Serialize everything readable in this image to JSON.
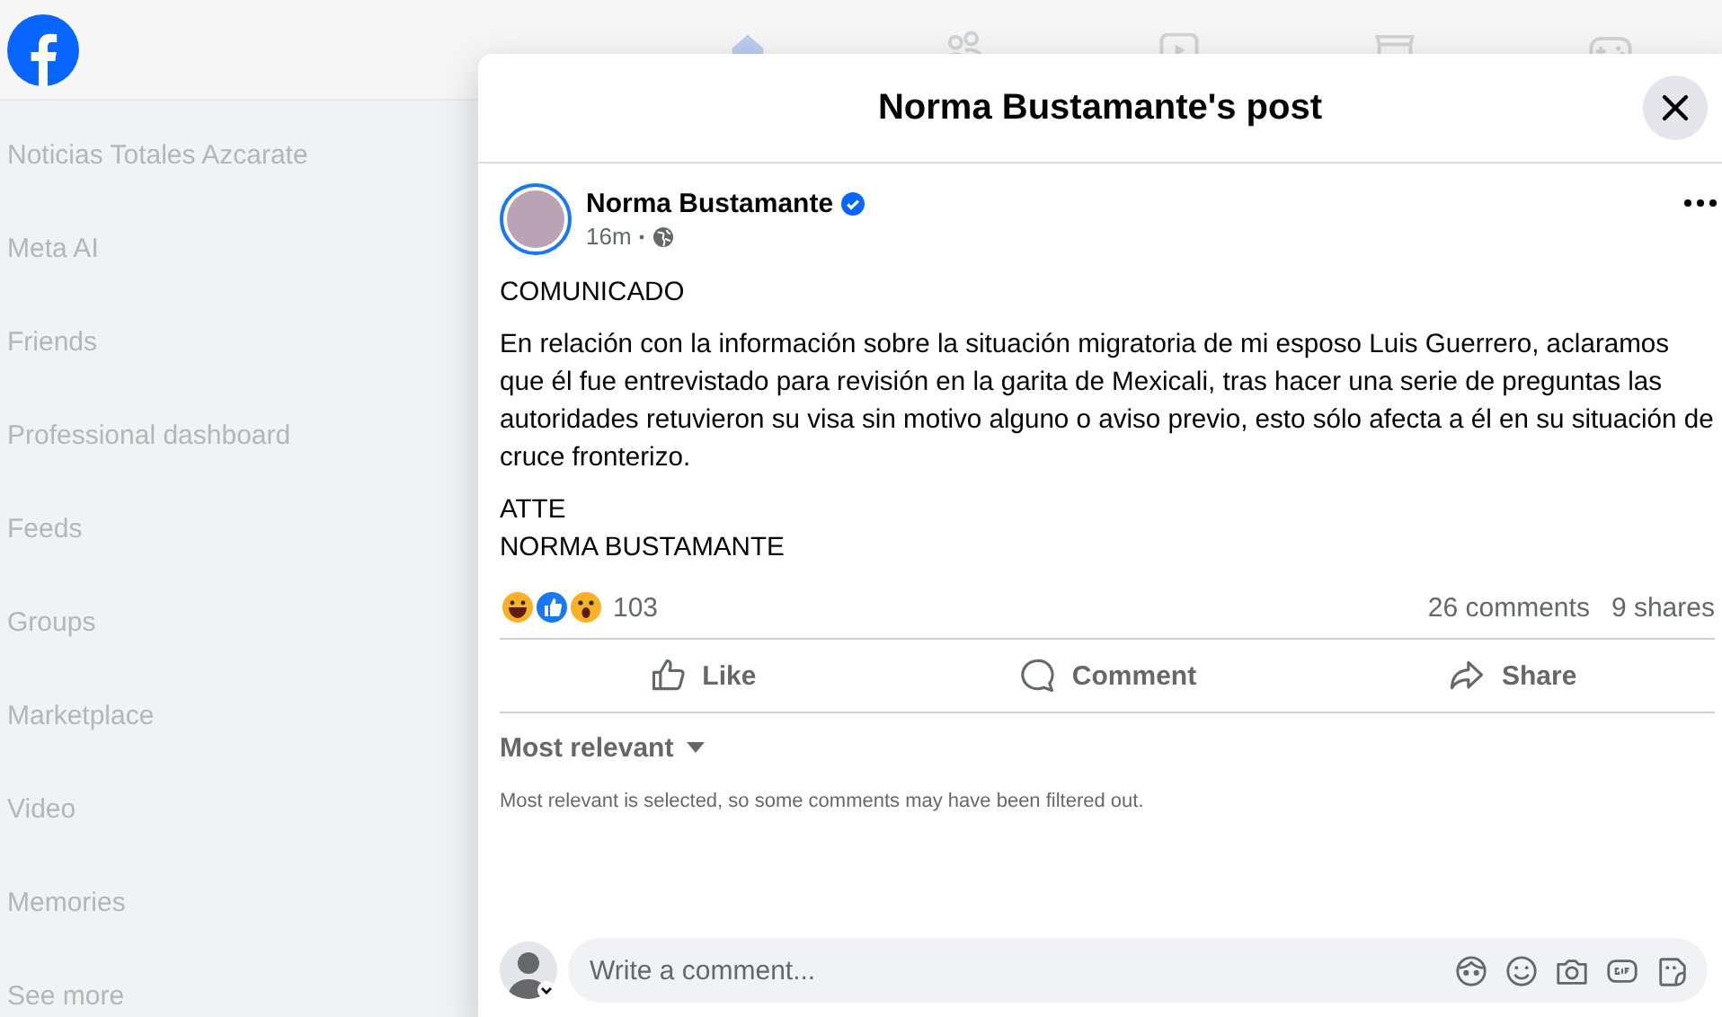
{
  "nav_tabs": [
    {
      "kind": "home",
      "selected": true
    },
    {
      "kind": "friends",
      "selected": false
    },
    {
      "kind": "video",
      "selected": false
    },
    {
      "kind": "marketplace",
      "selected": false
    },
    {
      "kind": "gaming",
      "selected": false
    }
  ],
  "sidebar": {
    "items": [
      {
        "label": "Noticias Totales Azcarate"
      },
      {
        "label": "Meta AI"
      },
      {
        "label": "Friends"
      },
      {
        "label": "Professional dashboard"
      },
      {
        "label": "Feeds"
      },
      {
        "label": "Groups"
      },
      {
        "label": "Marketplace"
      },
      {
        "label": "Video"
      },
      {
        "label": "Memories"
      },
      {
        "label": "See more"
      }
    ]
  },
  "dialog": {
    "title": "Norma Bustamante's post",
    "post": {
      "author": "Norma Bustamante",
      "verified": true,
      "time": "16m",
      "paragraphs": [
        "COMUNICADO",
        "En relación con la información sobre la situación migratoria de mi esposo Luis Guerrero, aclaramos que él fue entrevistado para revisión en la garita de Mexicali, tras hacer una serie de preguntas las autoridades retuvieron su visa sin motivo alguno o aviso previo, esto sólo afecta a él en su situación de cruce fronterizo.",
        "ATTE\nNORMA BUSTAMANTE"
      ],
      "reactions": [
        {
          "kind": "haha"
        },
        {
          "kind": "like"
        },
        {
          "kind": "wow"
        }
      ],
      "reaction_count": "103",
      "comments": "26 comments",
      "shares": "9 shares",
      "actions": [
        {
          "kind": "like",
          "label": "Like"
        },
        {
          "kind": "comment",
          "label": "Comment"
        },
        {
          "kind": "share",
          "label": "Share"
        }
      ]
    },
    "sort": {
      "label": "Most relevant"
    },
    "filter_note": "Most relevant is selected, so some comments may have been filtered out.",
    "comment_field": {
      "placeholder": "Write a comment...",
      "tools": [
        {
          "kind": "avatar"
        },
        {
          "kind": "emoji"
        },
        {
          "kind": "camera"
        },
        {
          "kind": "gif"
        },
        {
          "kind": "sticker"
        }
      ]
    }
  }
}
